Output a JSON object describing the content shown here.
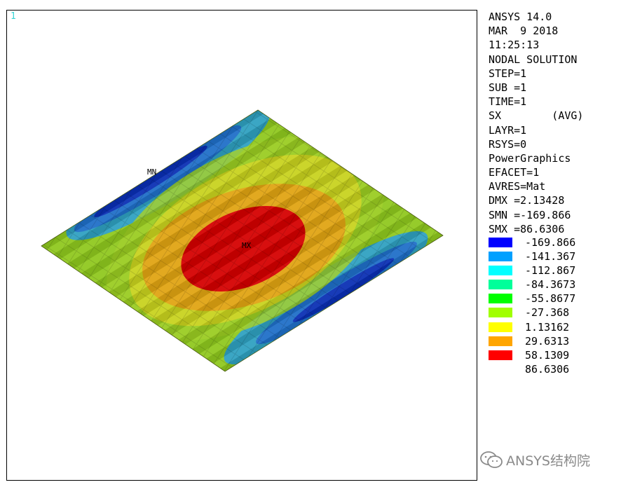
{
  "viewport": {
    "window_number": "1",
    "markers": {
      "min": "MN",
      "max": "MX"
    }
  },
  "info": [
    "ANSYS 14.0",
    "MAR  9 2018",
    "11:25:13",
    "NODAL SOLUTION",
    "STEP=1",
    "SUB =1",
    "TIME=1",
    "SX        (AVG)",
    "LAYR=1",
    "RSYS=0",
    "PowerGraphics",
    "EFACET=1",
    "AVRES=Mat",
    "DMX =2.13428",
    "SMN =-169.866",
    "SMX =86.6306"
  ],
  "legend": [
    {
      "value": "-169.866",
      "color": "#0000ff"
    },
    {
      "value": "-141.367",
      "color": "#00a0ff"
    },
    {
      "value": "-112.867",
      "color": "#00ffff"
    },
    {
      "value": "-84.3673",
      "color": "#00ff9a"
    },
    {
      "value": "-55.8677",
      "color": "#00ff00"
    },
    {
      "value": "-27.368",
      "color": "#a0ff00"
    },
    {
      "value": "1.13162",
      "color": "#ffff00"
    },
    {
      "value": "29.6313",
      "color": "#ffa500"
    },
    {
      "value": "58.1309",
      "color": "#ff0000"
    },
    {
      "value": "86.6306",
      "color": ""
    }
  ],
  "watermark": {
    "text": "ANSYS结构院",
    "icon": "wechat-icon"
  }
}
